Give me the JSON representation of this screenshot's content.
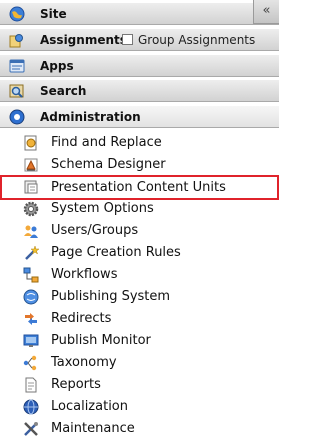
{
  "collapse_glyph": "«",
  "sections": {
    "site": {
      "label": "Site",
      "icon": "globe-icon"
    },
    "assignments": {
      "label": "Assignments",
      "icon": "assignments-icon",
      "checkbox_label": "Group Assignments",
      "checkbox_checked": false
    },
    "apps": {
      "label": "Apps",
      "icon": "apps-icon"
    },
    "search": {
      "label": "Search",
      "icon": "search-icon"
    },
    "administration": {
      "label": "Administration",
      "icon": "administration-icon"
    }
  },
  "admin_items": [
    {
      "label": "Find and Replace",
      "icon": "find-replace-icon"
    },
    {
      "label": "Schema Designer",
      "icon": "schema-designer-icon"
    },
    {
      "label": "Presentation Content Units",
      "icon": "presentation-icon",
      "selected": true
    },
    {
      "label": "System Options",
      "icon": "gear-icon"
    },
    {
      "label": "Users/Groups",
      "icon": "users-icon"
    },
    {
      "label": "Page Creation Rules",
      "icon": "wand-icon"
    },
    {
      "label": "Workflows",
      "icon": "workflow-icon"
    },
    {
      "label": "Publishing System",
      "icon": "publishing-icon"
    },
    {
      "label": "Redirects",
      "icon": "redirect-icon"
    },
    {
      "label": "Publish Monitor",
      "icon": "monitor-icon"
    },
    {
      "label": "Taxonomy",
      "icon": "taxonomy-icon"
    },
    {
      "label": "Reports",
      "icon": "report-icon"
    },
    {
      "label": "Localization",
      "icon": "localization-icon"
    },
    {
      "label": "Maintenance",
      "icon": "maintenance-icon"
    }
  ],
  "colors": {
    "selected_outline": "#e0232b"
  }
}
